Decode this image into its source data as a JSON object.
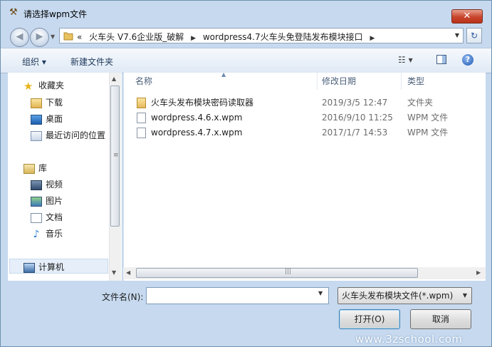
{
  "window": {
    "title": "请选择wpm文件",
    "close_label": "✕"
  },
  "address": {
    "prefix": "«",
    "crumbs": [
      "火车头 V7.6企业版_破解",
      "wordpress4.7火车头免登陆发布模块接口"
    ]
  },
  "toolbar": {
    "organize_label": "组织 ▾",
    "new_folder_label": "新建文件夹",
    "help_label": "?"
  },
  "nav": {
    "favorites_label": "收藏夹",
    "favorites": [
      "下载",
      "桌面",
      "最近访问的位置"
    ],
    "libraries_label": "库",
    "libraries": [
      "视频",
      "图片",
      "文档",
      "音乐"
    ],
    "computer_label": "计算机"
  },
  "files": {
    "columns": [
      "名称",
      "修改日期",
      "类型"
    ],
    "rows": [
      {
        "name": "火车头发布模块密码读取器",
        "date": "2019/3/5 12:47",
        "type": "文件夹",
        "icon": "folder-icon"
      },
      {
        "name": "wordpress.4.6.x.wpm",
        "date": "2016/9/10 11:25",
        "type": "WPM 文件",
        "icon": "file-icon"
      },
      {
        "name": "wordpress.4.7.x.wpm",
        "date": "2017/1/7 14:53",
        "type": "WPM 文件",
        "icon": "file-icon"
      }
    ]
  },
  "bottom": {
    "filename_label": "文件名(N):",
    "filename_value": "",
    "filter_value": "火车头发布模块文件(*.wpm)",
    "open_label": "打开(O)",
    "cancel_label": "取消"
  },
  "watermark": "www.3zschool.com",
  "colors": {
    "accent": "#3c7fb1",
    "close": "#c8452d",
    "chrome": "#c6d9ef"
  }
}
